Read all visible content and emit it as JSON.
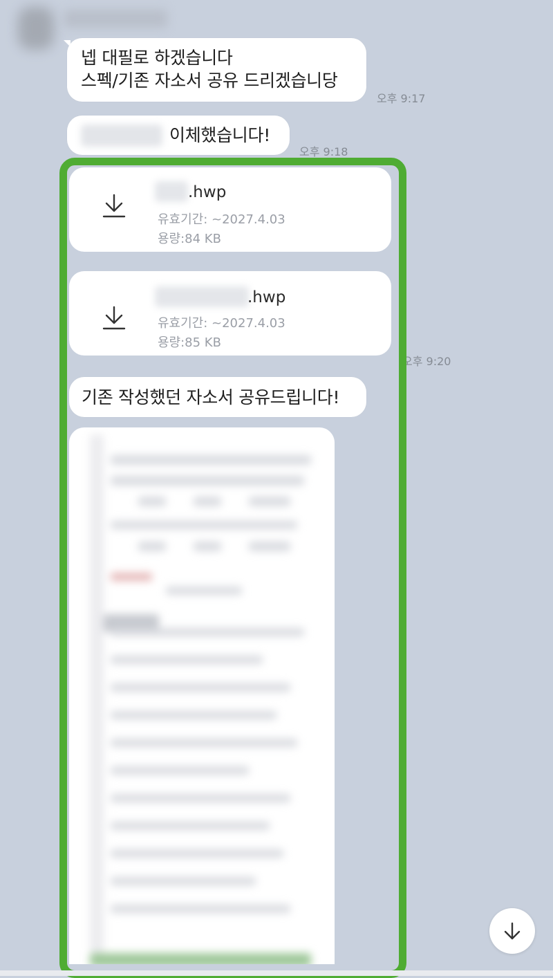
{
  "messages": [
    {
      "text": "넵 대필로 하겠습니다\n스펙/기존 자소서 공유 드리겠습니당",
      "time": "오후 9:17"
    },
    {
      "text": "이체했습니다!",
      "time": "오후 9:18"
    }
  ],
  "files": [
    {
      "ext": ".hwp",
      "expiry": "유효기간: ~2027.4.03",
      "size": "용량:84 KB",
      "icon": "download-icon"
    },
    {
      "ext": ".hwp",
      "expiry": "유효기간: ~2027.4.03",
      "size": "용량:85 KB",
      "icon": "download-icon"
    }
  ],
  "files_time": "오후 9:20",
  "share_message": "기존 작성했던 자소서 공유드립니다!",
  "scroll_button": {
    "icon": "arrow-down-icon"
  },
  "colors": {
    "background": "#c8d0dd",
    "highlight": "#4fac33",
    "bubble": "#ffffff",
    "time": "#858b94"
  }
}
